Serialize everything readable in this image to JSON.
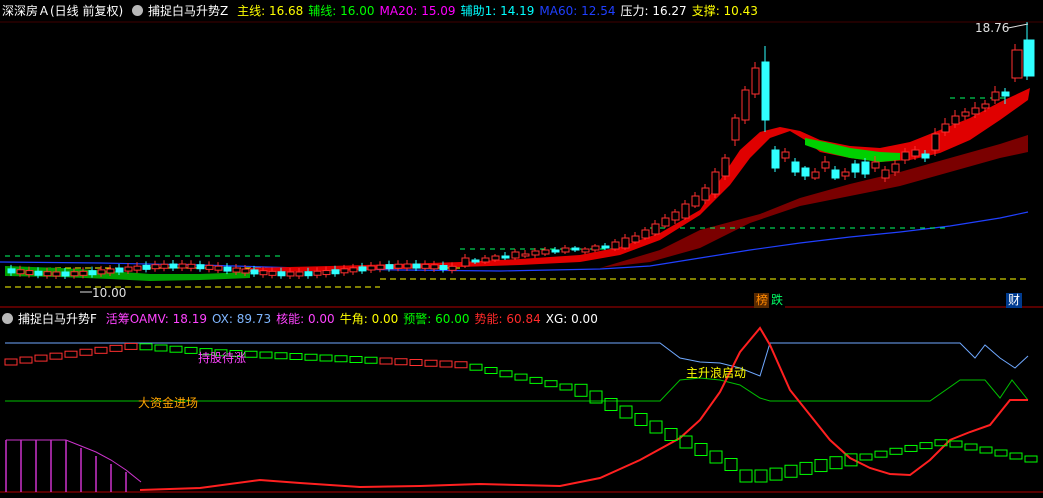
{
  "panel_top": {
    "title": "深深房Ａ(日线 前复权)",
    "indicator_name": "捕捉白马升势Z",
    "readouts": [
      {
        "label": "主线:",
        "value": "16.68",
        "color": "#ffff00"
      },
      {
        "label": "辅线:",
        "value": "16.00",
        "color": "#00ff00"
      },
      {
        "label": "MA20:",
        "value": "15.09",
        "color": "#ff00ff"
      },
      {
        "label": "辅助1:",
        "value": "14.19",
        "color": "#00ffff"
      },
      {
        "label": "MA60:",
        "value": "12.54",
        "color": "#1f3fff"
      },
      {
        "label": "压力:",
        "value": "16.27",
        "color": "#ffffff"
      },
      {
        "label": "支撑:",
        "value": "10.43",
        "color": "#ffff00"
      }
    ],
    "high_label": "18.76",
    "low_label": "10.00",
    "event_tags": [
      {
        "text": "榜",
        "color": "#ff8a00",
        "bg": "#5a2a00"
      },
      {
        "text": "跌",
        "color": "#00ff66",
        "bg": "#000000"
      },
      {
        "text": "财",
        "color": "#ffffff",
        "bg": "#003b8f"
      }
    ]
  },
  "panel_bottom": {
    "indicator_name": "捕捉白马升势F",
    "readouts": [
      {
        "label": "活筹OAMV:",
        "value": "18.19",
        "color": "#ff44ff"
      },
      {
        "label": "OX:",
        "value": "89.73",
        "color": "#7fb6ff"
      },
      {
        "label": "核能:",
        "value": "0.00",
        "color": "#ff44ff"
      },
      {
        "label": "牛角:",
        "value": "0.00",
        "color": "#ffff00"
      },
      {
        "label": "预警:",
        "value": "60.00",
        "color": "#00ff00"
      },
      {
        "label": "势能:",
        "value": "60.84",
        "color": "#ff2a2a"
      },
      {
        "label": "XG:",
        "value": "0.00",
        "color": "#ffffff"
      }
    ],
    "annotations": {
      "hold": "持股待涨",
      "main_wave": "主升浪启动",
      "big_money": "大资金进场"
    }
  },
  "chart_data": {
    "type": "candlestick",
    "title": "深深房Ａ(日线 前复权)",
    "y_labels_printed": [
      "18.76",
      "10.00"
    ],
    "reference_lines": [
      {
        "name": "压力",
        "value": 16.27
      },
      {
        "name": "支撑",
        "value": 10.43
      }
    ]
  }
}
